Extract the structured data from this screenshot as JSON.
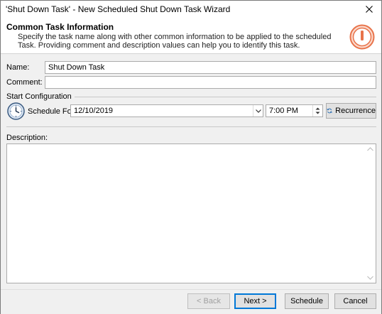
{
  "window": {
    "title": "'Shut Down Task' - New Scheduled Shut Down Task Wizard"
  },
  "header": {
    "title": "Common Task Information",
    "description": "Specify the task name along with other common information to be applied to the scheduled Task. Providing comment and description values can help you to identify this task.",
    "icon": "power-icon",
    "icon_color": "#e8734a"
  },
  "form": {
    "name_label": "Name:",
    "name_value": "Shut Down Task",
    "comment_label": "Comment:",
    "comment_value": "",
    "start_config_label": "Start Configuration",
    "schedule_for_label": "Schedule For:",
    "date_value": "12/10/2019",
    "time_value": "7:00 PM",
    "recurrence_label": "Recurrence",
    "description_label": "Description:",
    "description_value": ""
  },
  "footer": {
    "back_label": "< Back",
    "next_label": "Next >",
    "schedule_label": "Schedule",
    "cancel_label": "Cancel"
  }
}
